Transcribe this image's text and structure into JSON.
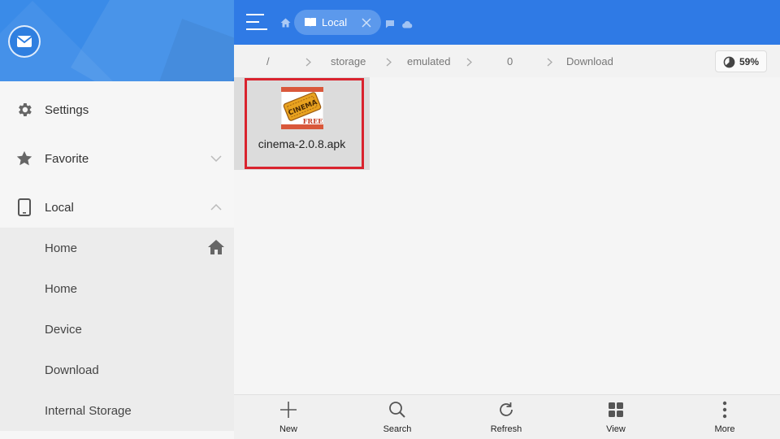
{
  "sidebar": {
    "items": [
      {
        "label": "Settings",
        "icon": "gear-icon"
      },
      {
        "label": "Favorite",
        "icon": "star-icon"
      },
      {
        "label": "Local",
        "icon": "phone-icon"
      }
    ],
    "local_sub": [
      {
        "label": "Home"
      },
      {
        "label": "Home"
      },
      {
        "label": "Device"
      },
      {
        "label": "Download"
      },
      {
        "label": "Internal Storage"
      }
    ]
  },
  "topbar": {
    "tab_label": "Local"
  },
  "path": {
    "crumbs": [
      "/",
      "storage",
      "emulated",
      "0",
      "Download"
    ],
    "storage_percent": "59%"
  },
  "files": [
    {
      "name": "cinema-2.0.8.apk",
      "icon_text": "CINEMA",
      "icon_badge": "FREE"
    }
  ],
  "bottombar": {
    "buttons": [
      {
        "label": "New",
        "icon": "plus-icon"
      },
      {
        "label": "Search",
        "icon": "search-icon"
      },
      {
        "label": "Refresh",
        "icon": "refresh-icon"
      },
      {
        "label": "View",
        "icon": "grid-view-icon"
      },
      {
        "label": "More",
        "icon": "more-vert-icon"
      }
    ]
  },
  "colors": {
    "accent": "#2f7ae5",
    "highlight": "#d9232e"
  }
}
